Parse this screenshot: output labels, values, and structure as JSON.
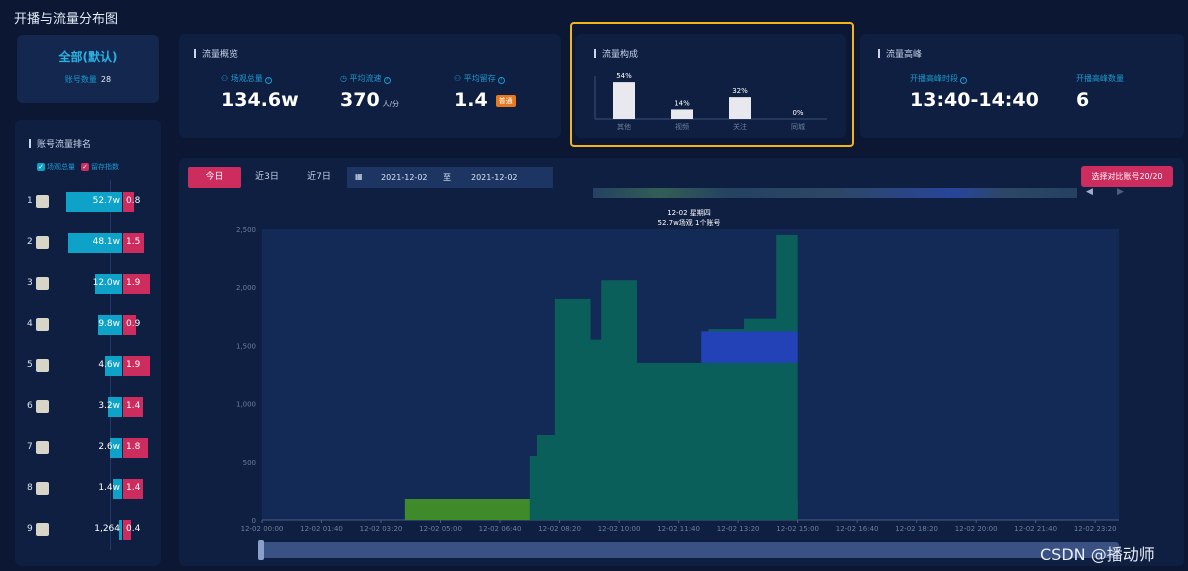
{
  "page_title": "开播与流量分布图",
  "account": {
    "name": "全部(默认)",
    "count_label": "账号数量",
    "count": "28"
  },
  "ranking": {
    "title": "账号流量排名",
    "legend": [
      "场观总量",
      "留存指数"
    ],
    "rows": [
      {
        "rank": "1",
        "views": "52.7w",
        "index": "0.8",
        "views_value": 52.7,
        "index_value": 0.8
      },
      {
        "rank": "2",
        "views": "48.1w",
        "index": "1.5",
        "views_value": 48.1,
        "index_value": 1.5
      },
      {
        "rank": "3",
        "views": "12.0w",
        "index": "1.9",
        "views_value": 12.0,
        "index_value": 1.9
      },
      {
        "rank": "4",
        "views": "9.8w",
        "index": "0.9",
        "views_value": 9.8,
        "index_value": 0.9
      },
      {
        "rank": "5",
        "views": "4.6w",
        "index": "1.9",
        "views_value": 4.6,
        "index_value": 1.9
      },
      {
        "rank": "6",
        "views": "3.2w",
        "index": "1.4",
        "views_value": 3.2,
        "index_value": 1.4
      },
      {
        "rank": "7",
        "views": "2.6w",
        "index": "1.8",
        "views_value": 2.6,
        "index_value": 1.8
      },
      {
        "rank": "8",
        "views": "1.4w",
        "index": "1.4",
        "views_value": 1.4,
        "index_value": 1.4
      },
      {
        "rank": "9",
        "views": "1,264",
        "index": "0.4",
        "views_value": 0.1264,
        "index_value": 0.4
      }
    ]
  },
  "overview": {
    "title": "流量概览",
    "total_label": "场观总量",
    "total_value": "134.6w",
    "avg_label": "平均流速",
    "avg_value": "370",
    "avg_unit": "人/分",
    "retention_label": "平均留存",
    "retention_value": "1.4",
    "retention_tag": "普通"
  },
  "composition": {
    "title": "流量构成",
    "chart_data": {
      "type": "bar",
      "categories": [
        "其他",
        "视频",
        "关注",
        "同城"
      ],
      "values": [
        54,
        14,
        32,
        0
      ],
      "value_labels": [
        "54%",
        "14%",
        "32%",
        "0%"
      ]
    }
  },
  "peak": {
    "title": "流量高峰",
    "period_label": "开播高峰时段",
    "period_value": "13:40-14:40",
    "count_label": "开播高峰数量",
    "count_value": "6"
  },
  "controls": {
    "tabs": [
      "今日",
      "近3日",
      "近7日"
    ],
    "date_start": "2021-12-02",
    "date_sep": "至",
    "date_end": "2021-12-02",
    "compare": "选择对比账号20/20"
  },
  "main_chart": {
    "tooltip_line1": "12-02 星期四",
    "tooltip_line2": "52.7w场观    1个账号",
    "colors": {
      "teal": "#0a5f5a",
      "blue": "#2442b8",
      "green": "#3f8a2a",
      "plot_bg": "#122a55"
    },
    "chart_data": {
      "type": "area",
      "ylim": [
        0,
        2500
      ],
      "yticks": [
        "0",
        "500",
        "1,000",
        "1,500",
        "2,000",
        "2,500"
      ],
      "xticks": [
        "12-02 00:00",
        "12-02 01:40",
        "12-02 03:20",
        "12-02 05:00",
        "12-02 06:40",
        "12-02 08:20",
        "12-02 10:00",
        "12-02 11:40",
        "12-02 13:20",
        "12-02 15:00",
        "12-02 16:40",
        "12-02 18:20",
        "12-02 20:00",
        "12-02 21:40",
        "12-02 23:20"
      ],
      "series": [
        {
          "name": "",
          "color": "green",
          "points": [
            [
              4.0,
              180
            ],
            [
              15.0,
              180
            ]
          ]
        },
        {
          "name": "",
          "color": "teal",
          "points": [
            [
              7.5,
              550
            ],
            [
              7.7,
              730
            ],
            [
              8.2,
              1900
            ],
            [
              9.2,
              1550
            ],
            [
              9.5,
              2060
            ],
            [
              10.5,
              1350
            ],
            [
              11.5,
              1350
            ],
            [
              12.5,
              1640
            ],
            [
              13.5,
              1730
            ],
            [
              14.4,
              2450
            ],
            [
              15.0,
              2450
            ]
          ]
        },
        {
          "name": "",
          "color": "blue",
          "points": [
            [
              12.3,
              1620
            ],
            [
              15.0,
              1630
            ]
          ]
        }
      ]
    }
  },
  "watermark": "CSDN @播动师"
}
